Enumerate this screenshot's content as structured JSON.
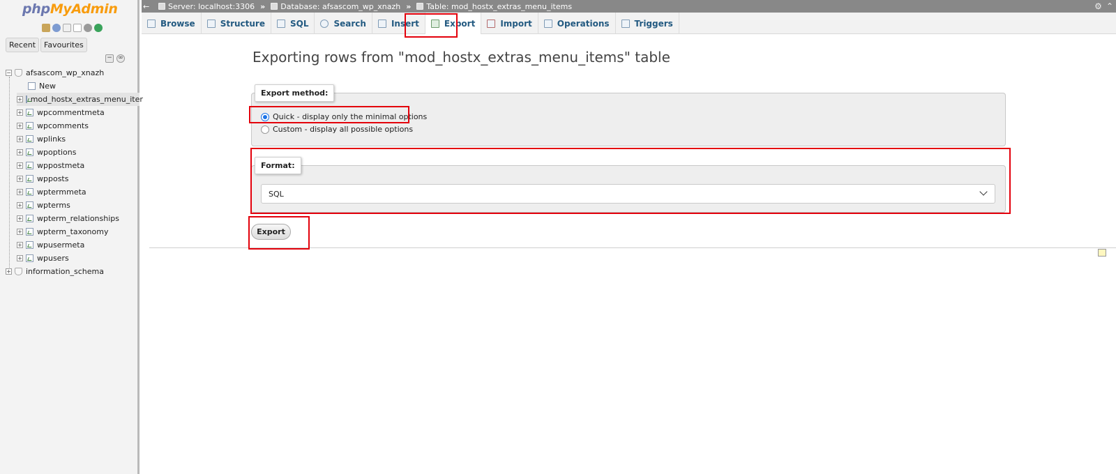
{
  "navigation": {
    "logo_php": "php",
    "logo_myadmin": "MyAdmin",
    "buttons": {
      "recent": "Recent",
      "favourites": "Favourites"
    },
    "tree": {
      "database": "afsascom_wp_xnazh",
      "new_label": "New",
      "tables": [
        "mod_hostx_extras_menu_iter",
        "wpcommentmeta",
        "wpcomments",
        "wplinks",
        "wpoptions",
        "wppostmeta",
        "wpposts",
        "wptermmeta",
        "wpterms",
        "wpterm_relationships",
        "wpterm_taxonomy",
        "wpusermeta",
        "wpusers"
      ],
      "other_database": "information_schema"
    }
  },
  "breadcrumb": {
    "server": "Server: localhost:3306",
    "database": "Database: afsascom_wp_xnazh",
    "table": "Table: mod_hostx_extras_menu_items",
    "separator": "»"
  },
  "tabs": [
    {
      "label": "Browse",
      "icon": "browse-icon",
      "active": false
    },
    {
      "label": "Structure",
      "icon": "structure-icon",
      "active": false
    },
    {
      "label": "SQL",
      "icon": "sql-icon",
      "active": false
    },
    {
      "label": "Search",
      "icon": "search-icon",
      "active": false
    },
    {
      "label": "Insert",
      "icon": "insert-icon",
      "active": false
    },
    {
      "label": "Export",
      "icon": "export-icon",
      "active": true
    },
    {
      "label": "Import",
      "icon": "import-icon",
      "active": false
    },
    {
      "label": "Operations",
      "icon": "operations-icon",
      "active": false
    },
    {
      "label": "Triggers",
      "icon": "triggers-icon",
      "active": false
    }
  ],
  "main": {
    "title": "Exporting rows from \"mod_hostx_extras_menu_items\" table",
    "export_method": {
      "legend": "Export method:",
      "options": [
        {
          "label": "Quick - display only the minimal options",
          "checked": true
        },
        {
          "label": "Custom - display all possible options",
          "checked": false
        }
      ]
    },
    "format": {
      "legend": "Format:",
      "selected": "SQL"
    },
    "export_button": "Export"
  },
  "colors": {
    "highlight": "#e3000b",
    "tab_text": "#235a81",
    "logo_php": "#6c78af",
    "logo_myadmin": "#f89c0e"
  }
}
